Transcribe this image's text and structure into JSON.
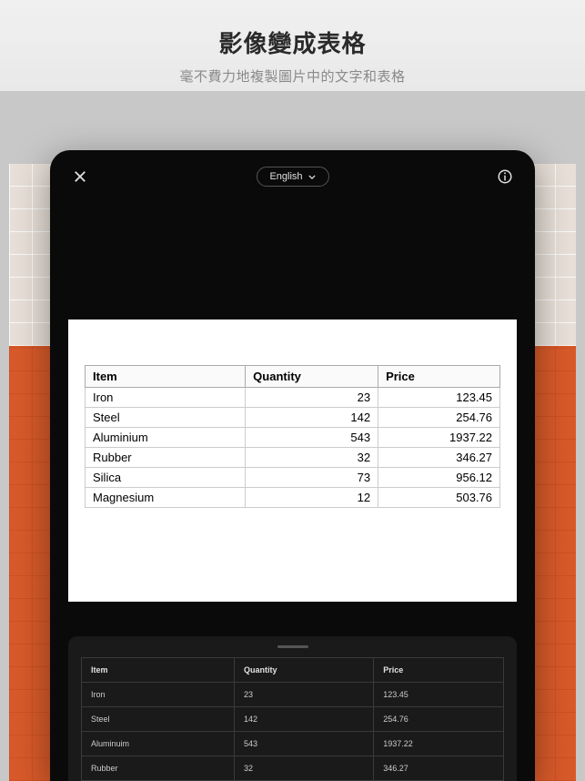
{
  "promo": {
    "title": "影像變成表格",
    "subtitle": "毫不費力地複製圖片中的文字和表格"
  },
  "app": {
    "language": "English"
  },
  "doc_table": {
    "headers": [
      "Item",
      "Quantity",
      "Price"
    ],
    "rows": [
      {
        "item": "Iron",
        "qty": "23",
        "price": "123.45"
      },
      {
        "item": "Steel",
        "qty": "142",
        "price": "254.76"
      },
      {
        "item": "Aluminium",
        "qty": "543",
        "price": "1937.22"
      },
      {
        "item": "Rubber",
        "qty": "32",
        "price": "346.27"
      },
      {
        "item": "Silica",
        "qty": "73",
        "price": "956.12"
      },
      {
        "item": "Magnesium",
        "qty": "12",
        "price": "503.76"
      }
    ]
  },
  "result_table": {
    "headers": [
      "Item",
      "Quantity",
      "Price"
    ],
    "rows": [
      {
        "item": "Iron",
        "qty": "23",
        "price": "123.45"
      },
      {
        "item": "Steel",
        "qty": "142",
        "price": "254.76"
      },
      {
        "item": "Aluminuim",
        "qty": "543",
        "price": "1937.22"
      },
      {
        "item": "Rubber",
        "qty": "32",
        "price": "346.27"
      }
    ]
  }
}
